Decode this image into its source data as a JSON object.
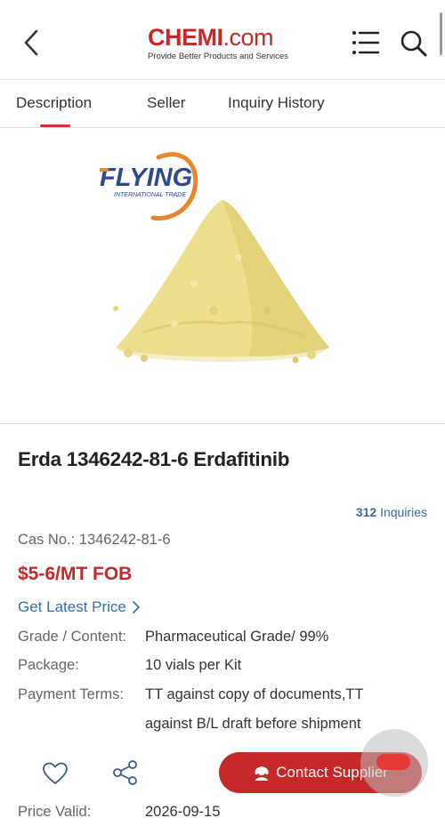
{
  "header": {
    "logo_main": "CHEMI",
    "logo_dotcom": ".com",
    "logo_tagline": "Provide Better Products and Services",
    "icons": [
      "back-arrow-icon",
      "menu-list-icon",
      "search-icon"
    ]
  },
  "tabs": [
    {
      "label": "Description",
      "active": true
    },
    {
      "label": "Seller",
      "active": false
    },
    {
      "label": "Inquiry History",
      "active": false
    }
  ],
  "product_image": {
    "brand_text": "FLYING",
    "brand_subtext": "INTERNATIONAL TRADE"
  },
  "product": {
    "title": "Erda 1346242-81-6 Erdafitinib",
    "inquiries_count": "312",
    "inquiries_label": "Inquiries",
    "cas": "Cas No.: 1346242-81-6",
    "price": "$5-6/MT FOB",
    "latest_price_link": "Get Latest Price"
  },
  "specs": {
    "grade_label": "Grade / Content:",
    "grade_value": "Pharmaceutical Grade/ 99%",
    "package_label": "Package:",
    "package_value": "10 vials per Kit",
    "payment_label": "Payment Terms:",
    "payment_value_line1": "TT against copy of documents,TT",
    "payment_value_line2": "against B/L draft before shipment",
    "valid_label": "Price Valid:",
    "valid_value": "2026-09-15"
  },
  "actions": {
    "contact_label": "Contact Supplier"
  },
  "colors": {
    "brand_red": "#c62828",
    "link_blue": "#2f6fb5",
    "inquiry_blue": "#3b6a9e",
    "powder_yellow": "#ecdf8e"
  }
}
